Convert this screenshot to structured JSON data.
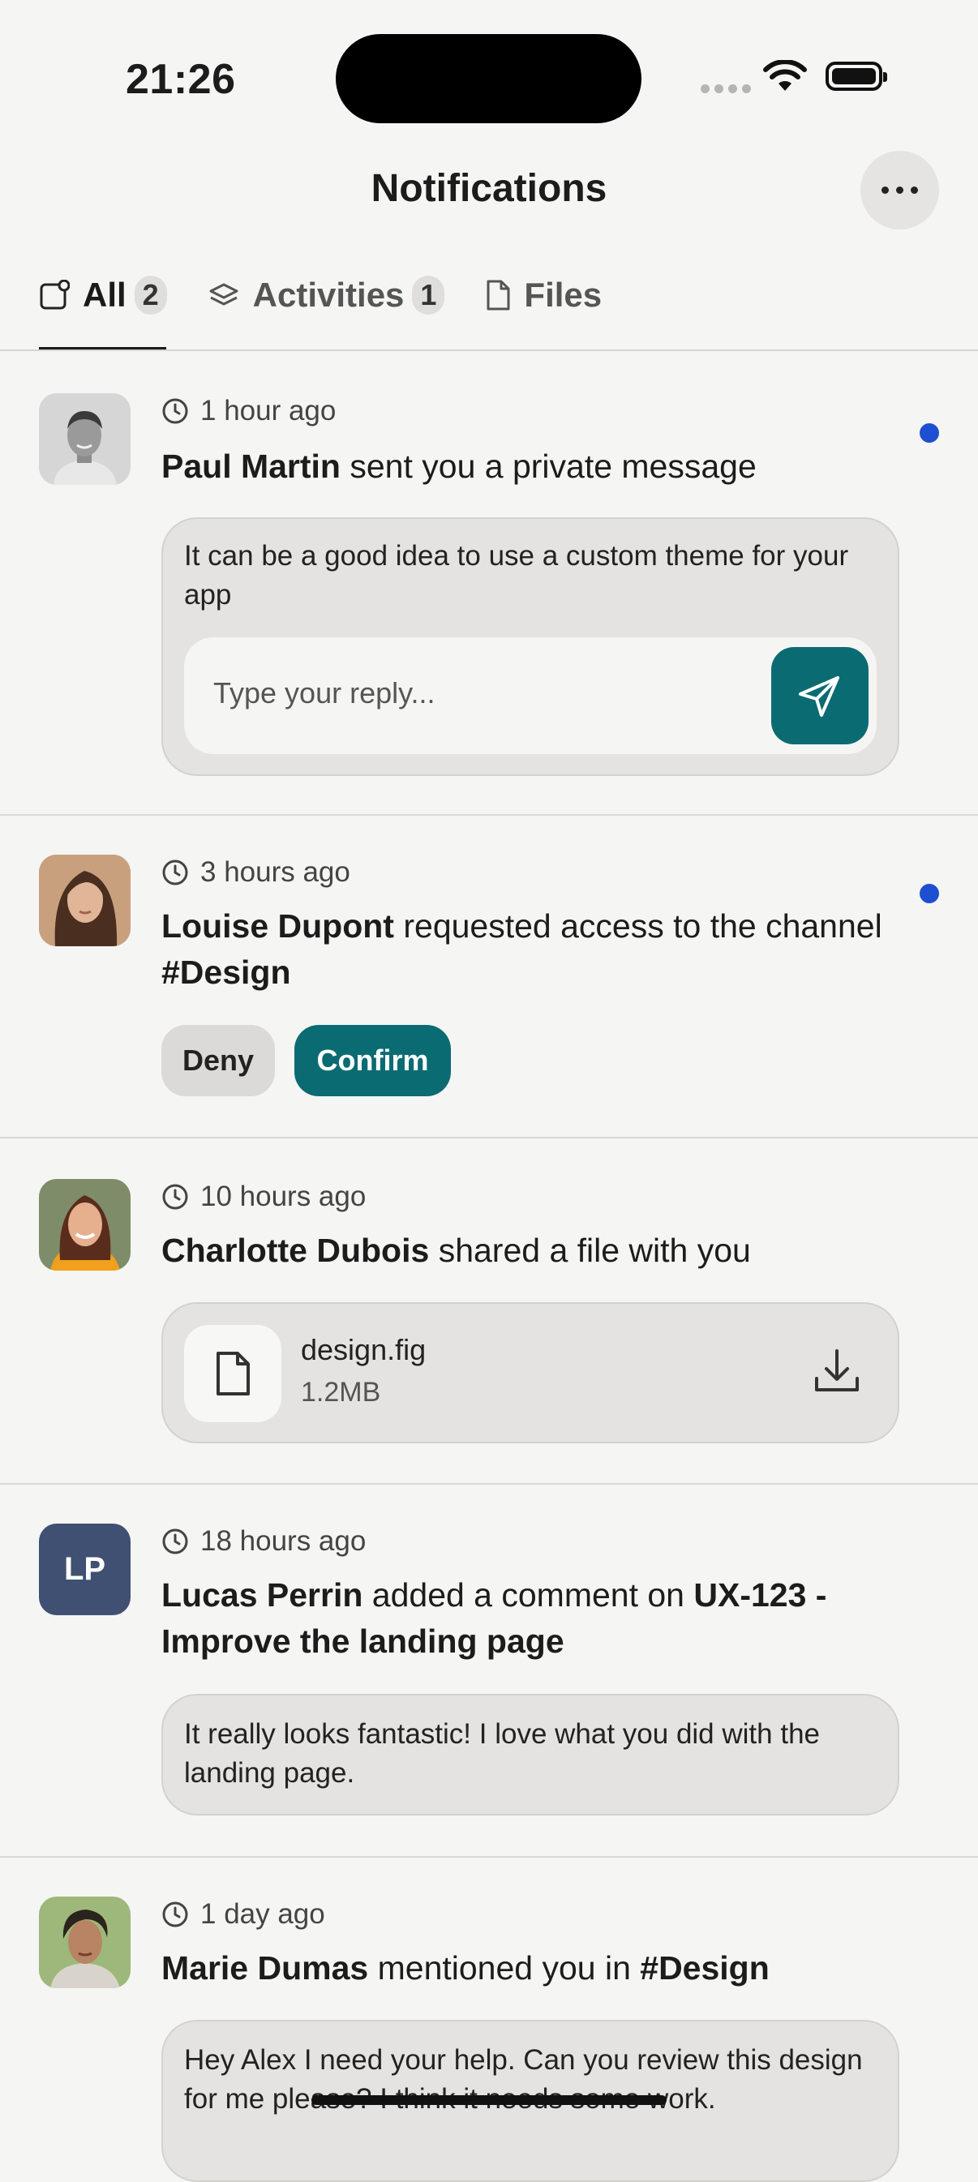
{
  "status_bar": {
    "time": "21:26"
  },
  "header": {
    "title": "Notifications"
  },
  "tabs": [
    {
      "label": "All",
      "count": "2"
    },
    {
      "label": "Activities",
      "count": "1"
    },
    {
      "label": "Files"
    }
  ],
  "notifications": [
    {
      "time": "1 hour ago",
      "name": "Paul Martin",
      "action": " sent you a private message",
      "message": "It can be a good idea to use a custom theme for your app",
      "reply_placeholder": "Type your reply...",
      "unread": true
    },
    {
      "time": "3 hours ago",
      "name": "Louise Dupont",
      "action": " requested access to the channel ",
      "channel": "#Design",
      "deny_label": "Deny",
      "confirm_label": "Confirm",
      "unread": true
    },
    {
      "time": "10 hours ago",
      "name": "Charlotte Dubois",
      "action": " shared a file with you",
      "file_name": "design.fig",
      "file_size": "1.2MB"
    },
    {
      "time": "18 hours ago",
      "initials": "LP",
      "name": "Lucas Perrin",
      "action": " added a comment on ",
      "target": "UX-123 - Improve the landing page",
      "comment": "It really looks fantastic! I love what you did with the landing page."
    },
    {
      "time": "1 day ago",
      "name": "Marie Dumas",
      "action": " mentioned you in ",
      "channel": "#Design",
      "message": "Hey Alex I need your help. Can you review this design for me please? I think it needs some work."
    }
  ],
  "colors": {
    "accent": "#0b6b72",
    "unread_dot": "#1f4fd1",
    "background": "#f5f5f4"
  }
}
